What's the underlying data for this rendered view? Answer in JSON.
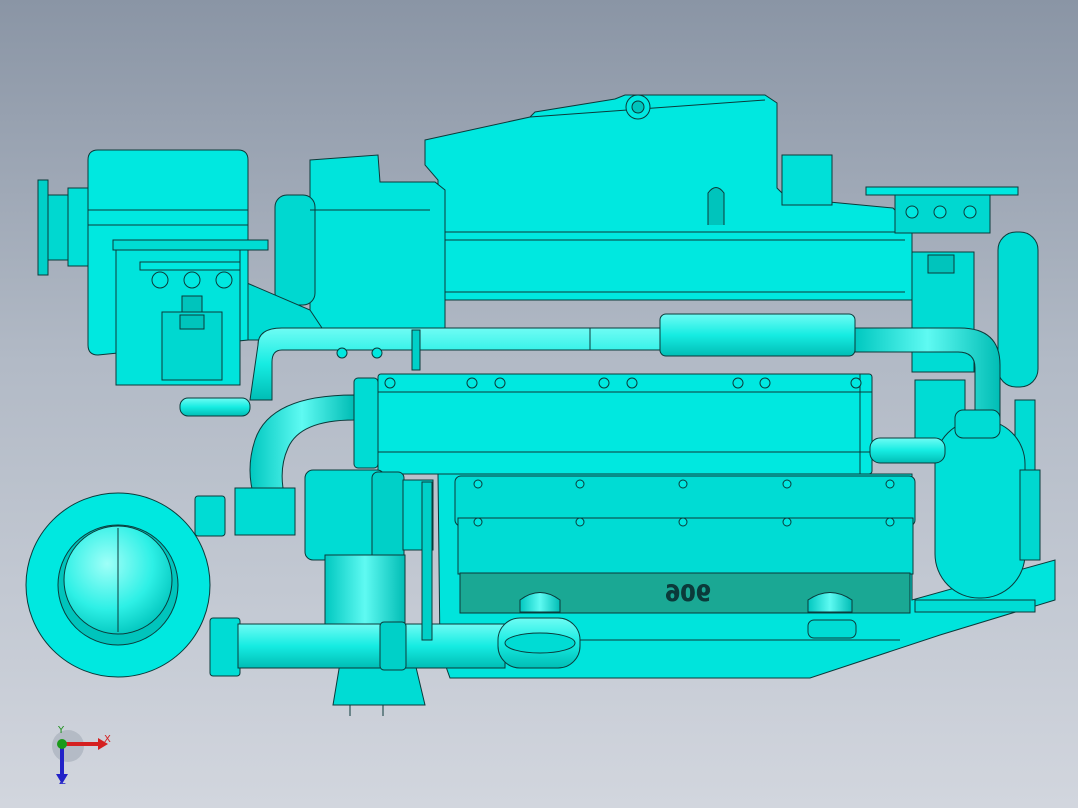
{
  "viewport": {
    "background_top": "#8a95a5",
    "background_bottom": "#d2d6de"
  },
  "model": {
    "body_color": "#00e8e0",
    "shade_color": "#00c4bc",
    "dark_color": "#1aa894",
    "edge_color": "#0b3a3a",
    "sump_marking": "906"
  },
  "triad": {
    "x_label": "X",
    "y_label": "Y",
    "z_label": "Z",
    "x_color": "#d52020",
    "y_color": "#1a9a1a",
    "z_color": "#2222c8"
  }
}
